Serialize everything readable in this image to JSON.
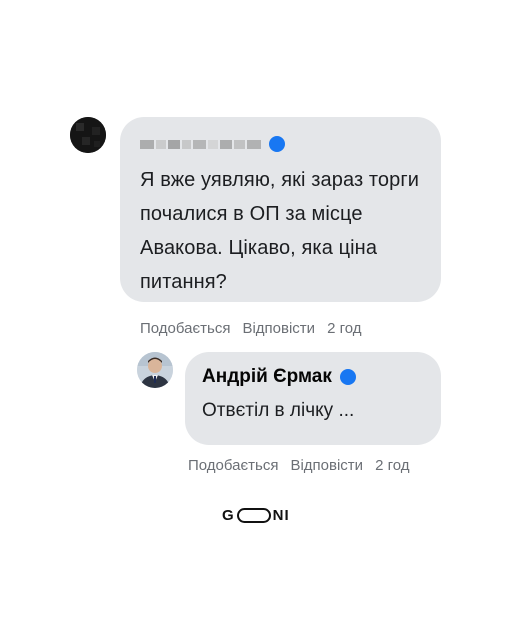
{
  "comment": {
    "author_name_hidden": true,
    "text": "Я вже уявляю, які зараз торги почалися в ОП за місце Авакова. Цікаво, яка ціна питання?",
    "actions": {
      "like": "Подобається",
      "reply": "Відповісти",
      "time": "2 год"
    }
  },
  "reply": {
    "author_name": "Андрій Єрмак",
    "text": "Отвєтіл в лічку ...",
    "actions": {
      "like": "Подобається",
      "reply": "Відповісти",
      "time": "2 год"
    }
  },
  "logo": {
    "left": "G",
    "right": "NI"
  },
  "colors": {
    "bubble": "#e4e6e9",
    "verified": "#1877f2",
    "meta_text": "#6b6f75"
  },
  "icons": {
    "verified": "verified-badge-icon"
  }
}
